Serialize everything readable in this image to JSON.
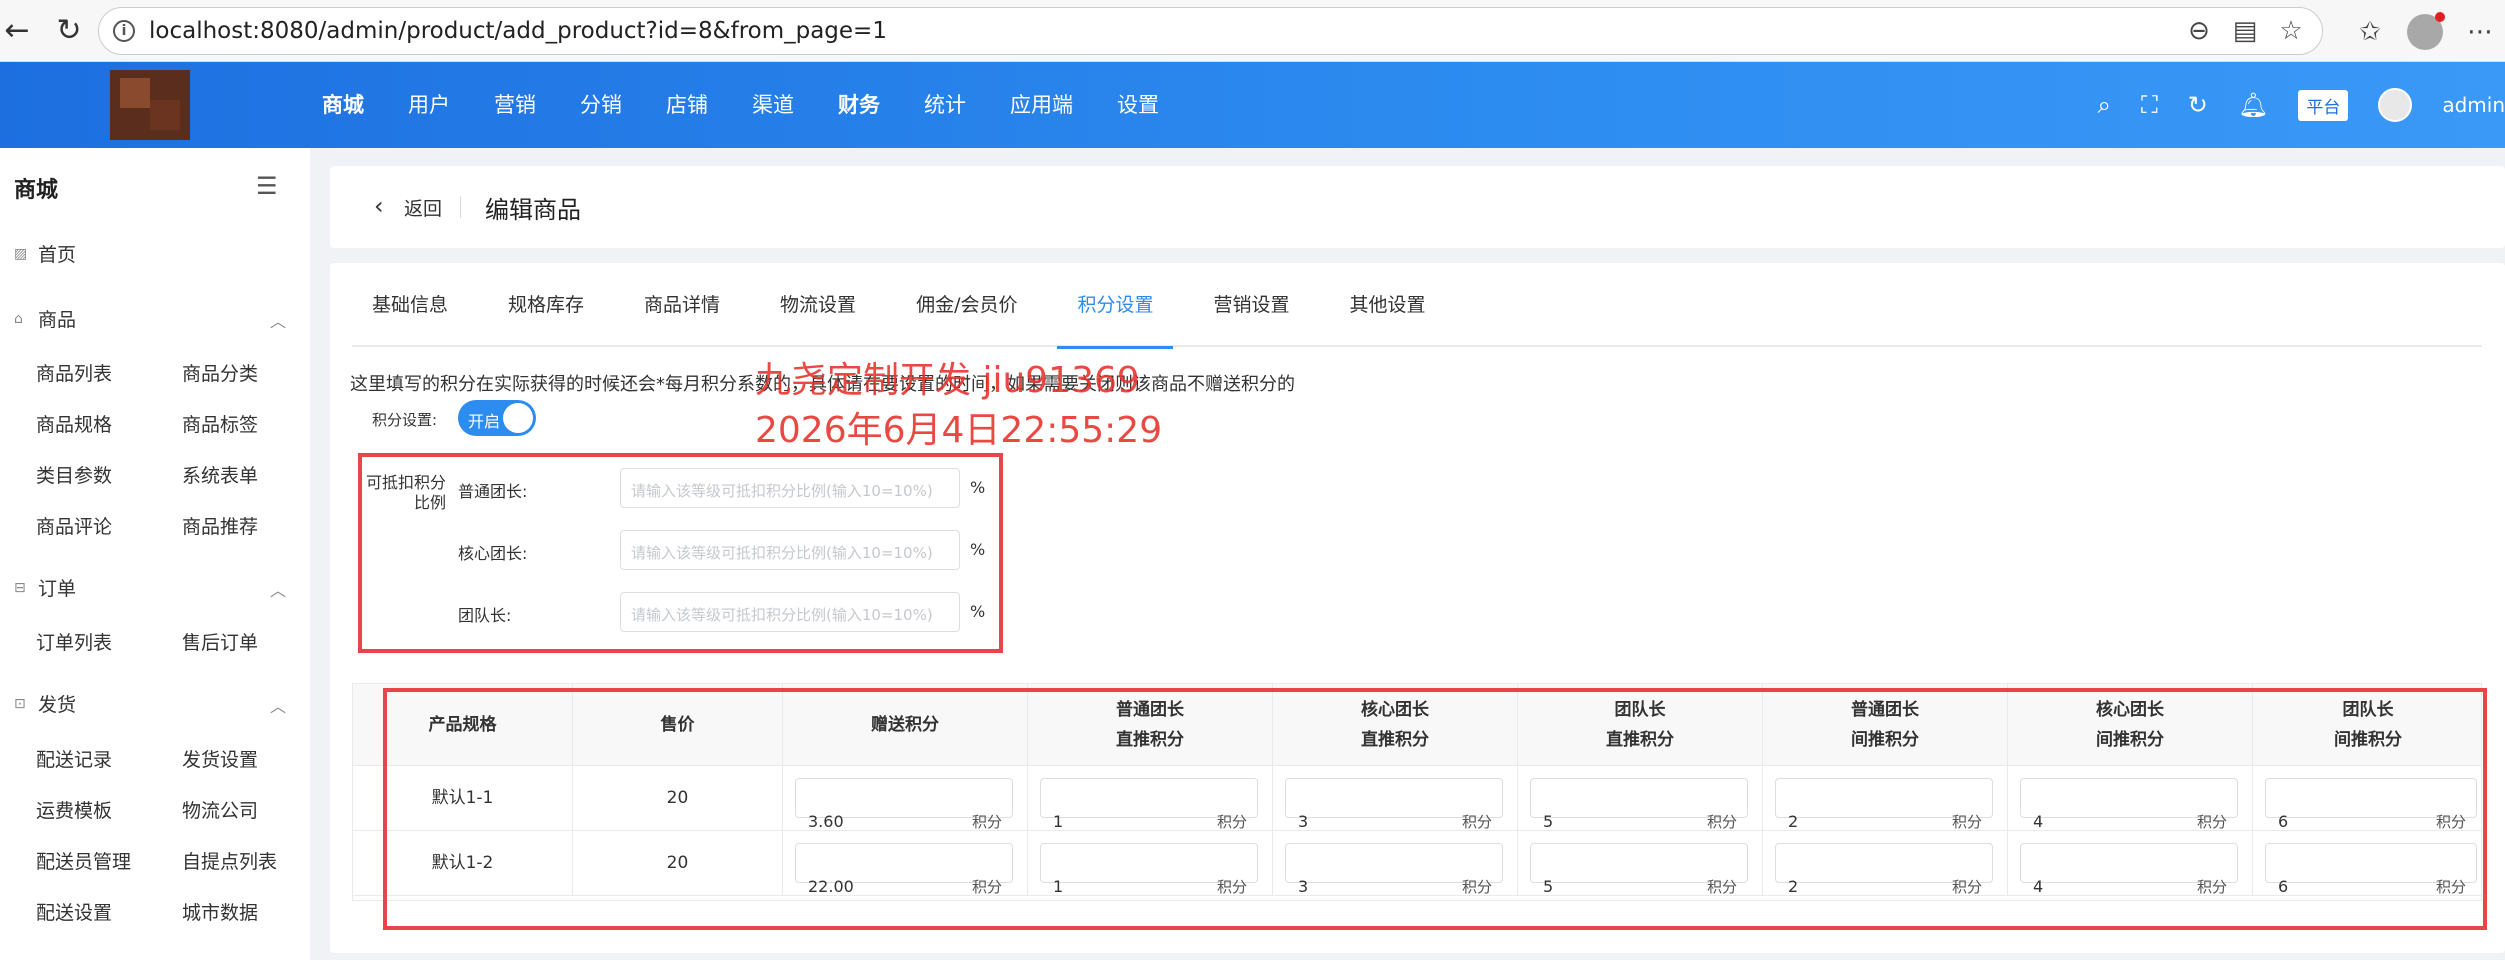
{
  "browser": {
    "url": "localhost:8080/admin/product/add_product?id=8&from_page=1"
  },
  "header": {
    "nav_items": [
      "商城",
      "用户",
      "营销",
      "分销",
      "店铺",
      "渠道",
      "财务",
      "统计",
      "应用端",
      "设置"
    ],
    "platform_badge": "平台",
    "admin_name": "admin"
  },
  "sidebar": {
    "title": "商城",
    "home": "首页",
    "groups": [
      {
        "label": "商品",
        "items": [
          "商品列表",
          "商品分类",
          "商品规格",
          "商品标签",
          "类目参数",
          "系统表单",
          "商品评论",
          "商品推荐"
        ]
      },
      {
        "label": "订单",
        "items": [
          "订单列表",
          "售后订单"
        ]
      },
      {
        "label": "发货",
        "items": [
          "配送记录",
          "发货设置",
          "运费模板",
          "物流公司",
          "配送员管理",
          "自提点列表",
          "配送设置",
          "城市数据"
        ]
      }
    ]
  },
  "title_bar": {
    "back_label": "返回",
    "page_title": "编辑商品"
  },
  "tabs": [
    "基础信息",
    "规格库存",
    "商品详情",
    "物流设置",
    "佣金/会员价",
    "积分设置",
    "营销设置",
    "其他设置"
  ],
  "active_tab": "积分设置",
  "points": {
    "hint": "这里填写的积分在实际获得的时候还会*每月积分系数的，具体请在要设置的时间，如果需要关闭则该商品不赠送积分的",
    "switch_label": "积分设置:",
    "switch_text": "开启",
    "ratio_label": "可抵扣积分比例",
    "ratio_rows": [
      {
        "label": "普通团长:",
        "placeholder": "请输入该等级可抵扣积分比例(输入10=10%)",
        "unit": "%"
      },
      {
        "label": "核心团长:",
        "placeholder": "请输入该等级可抵扣积分比例(输入10=10%)",
        "unit": "%"
      },
      {
        "label": "团队长:",
        "placeholder": "请输入该等级可抵扣积分比例(输入10=10%)",
        "unit": "%"
      }
    ]
  },
  "watermark": {
    "line1": "九尧定制开发 jiu91369",
    "line2": "2026年6月4日22:55:29"
  },
  "table": {
    "headers": [
      [
        "产品规格"
      ],
      [
        "售价"
      ],
      [
        "赠送积分"
      ],
      [
        "普通团长",
        "直推积分"
      ],
      [
        "核心团长",
        "直推积分"
      ],
      [
        "团队长",
        "直推积分"
      ],
      [
        "普通团长",
        "间推积分"
      ],
      [
        "核心团长",
        "间推积分"
      ],
      [
        "团队长",
        "间推积分"
      ]
    ],
    "unit": "积分",
    "rows": [
      {
        "spec": "默认1-1",
        "price": "20",
        "values": [
          "3.60",
          "1",
          "3",
          "5",
          "2",
          "4",
          "6"
        ]
      },
      {
        "spec": "默认1-2",
        "price": "20",
        "values": [
          "22.00",
          "1",
          "3",
          "5",
          "2",
          "4",
          "6"
        ]
      }
    ]
  },
  "colors": {
    "primary": "#2d8cf0",
    "annotation_red": "#e8454a"
  }
}
